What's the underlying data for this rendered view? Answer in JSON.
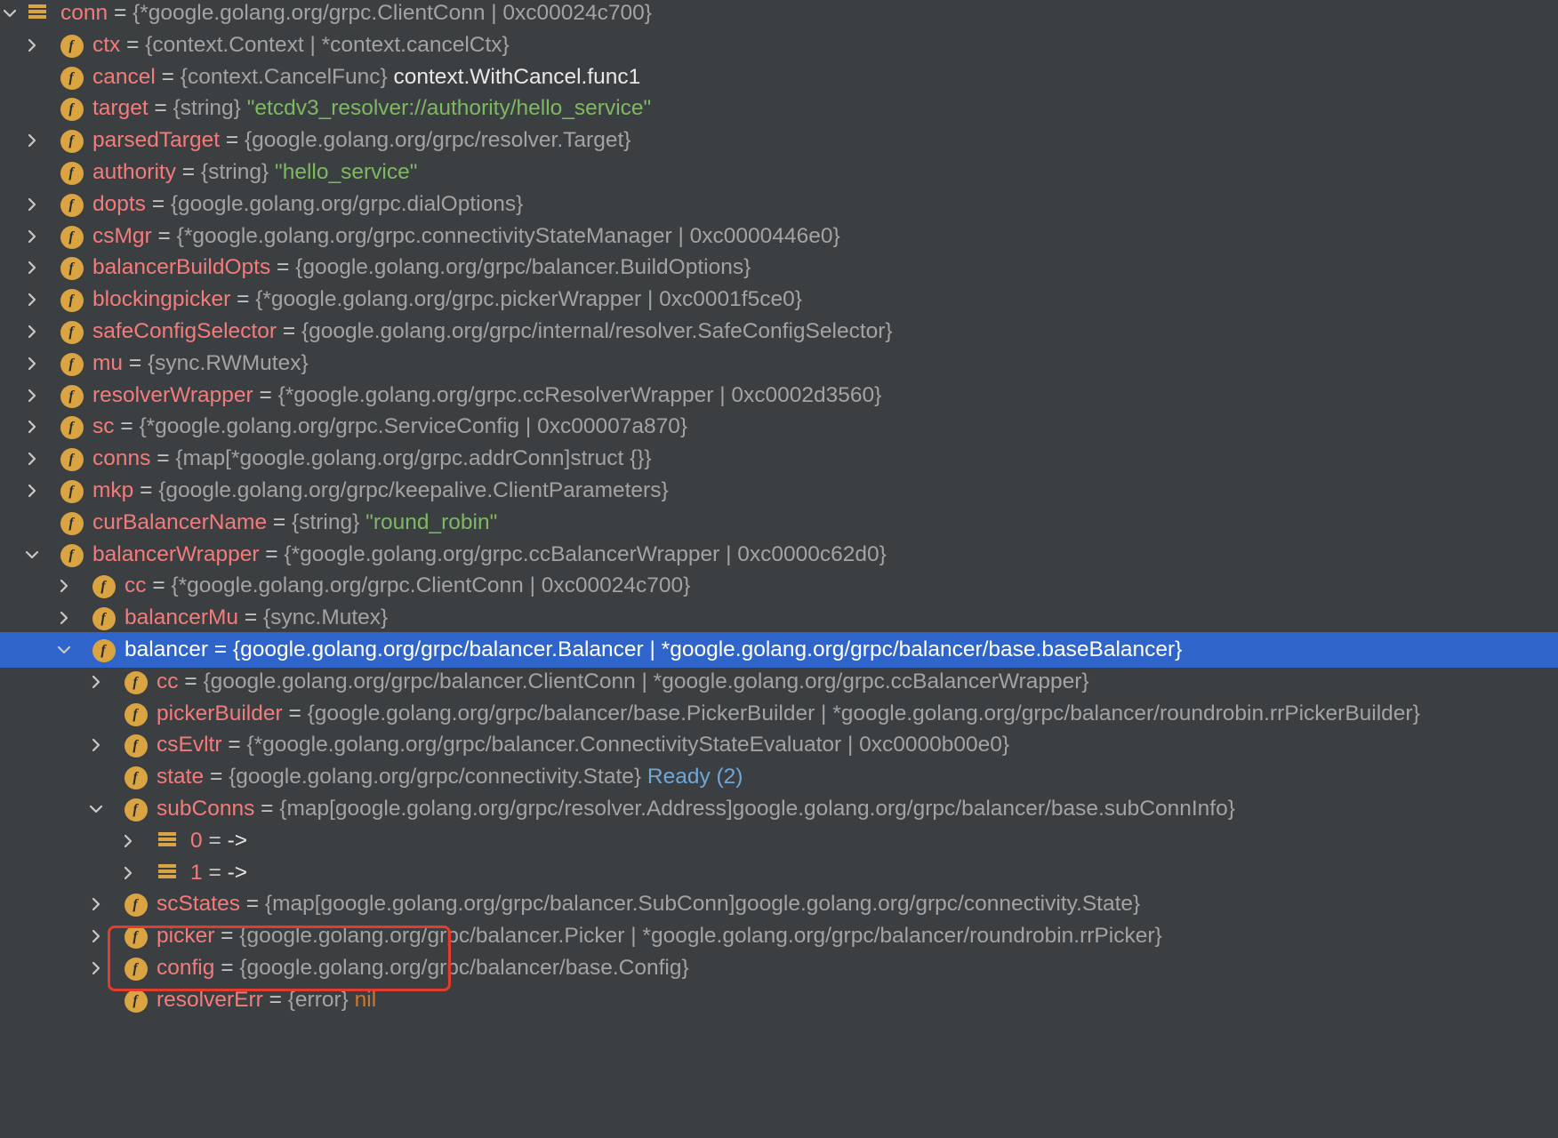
{
  "variables": [
    {
      "depth": 0,
      "expand": "expanded",
      "icon": "array-icon",
      "name": "conn",
      "type": "{*google.golang.org/grpc.ClientConn | 0xc00024c700}",
      "value": "",
      "value_kind": ""
    },
    {
      "depth": 1,
      "expand": "collapsed",
      "icon": "field-icon",
      "name": "ctx",
      "type": "{context.Context | *context.cancelCtx}",
      "value": "",
      "value_kind": ""
    },
    {
      "depth": 1,
      "expand": "none",
      "icon": "field-icon",
      "name": "cancel",
      "type": "{context.CancelFunc}",
      "value": "context.WithCancel.func1",
      "value_kind": "plain"
    },
    {
      "depth": 1,
      "expand": "none",
      "icon": "field-icon",
      "name": "target",
      "type": "{string}",
      "value": "\"etcdv3_resolver://authority/hello_service\"",
      "value_kind": "string"
    },
    {
      "depth": 1,
      "expand": "collapsed",
      "icon": "field-icon",
      "name": "parsedTarget",
      "type": "{google.golang.org/grpc/resolver.Target}",
      "value": "",
      "value_kind": ""
    },
    {
      "depth": 1,
      "expand": "none",
      "icon": "field-icon",
      "name": "authority",
      "type": "{string}",
      "value": "\"hello_service\"",
      "value_kind": "string"
    },
    {
      "depth": 1,
      "expand": "collapsed",
      "icon": "field-icon",
      "name": "dopts",
      "type": "{google.golang.org/grpc.dialOptions}",
      "value": "",
      "value_kind": ""
    },
    {
      "depth": 1,
      "expand": "collapsed",
      "icon": "field-icon",
      "name": "csMgr",
      "type": "{*google.golang.org/grpc.connectivityStateManager | 0xc0000446e0}",
      "value": "",
      "value_kind": ""
    },
    {
      "depth": 1,
      "expand": "collapsed",
      "icon": "field-icon",
      "name": "balancerBuildOpts",
      "type": "{google.golang.org/grpc/balancer.BuildOptions}",
      "value": "",
      "value_kind": ""
    },
    {
      "depth": 1,
      "expand": "collapsed",
      "icon": "field-icon",
      "name": "blockingpicker",
      "type": "{*google.golang.org/grpc.pickerWrapper | 0xc0001f5ce0}",
      "value": "",
      "value_kind": ""
    },
    {
      "depth": 1,
      "expand": "collapsed",
      "icon": "field-icon",
      "name": "safeConfigSelector",
      "type": "{google.golang.org/grpc/internal/resolver.SafeConfigSelector}",
      "value": "",
      "value_kind": ""
    },
    {
      "depth": 1,
      "expand": "collapsed",
      "icon": "field-icon",
      "name": "mu",
      "type": "{sync.RWMutex}",
      "value": "",
      "value_kind": ""
    },
    {
      "depth": 1,
      "expand": "collapsed",
      "icon": "field-icon",
      "name": "resolverWrapper",
      "type": "{*google.golang.org/grpc.ccResolverWrapper | 0xc0002d3560}",
      "value": "",
      "value_kind": ""
    },
    {
      "depth": 1,
      "expand": "collapsed",
      "icon": "field-icon",
      "name": "sc",
      "type": "{*google.golang.org/grpc.ServiceConfig | 0xc00007a870}",
      "value": "",
      "value_kind": ""
    },
    {
      "depth": 1,
      "expand": "collapsed",
      "icon": "field-icon",
      "name": "conns",
      "type": "{map[*google.golang.org/grpc.addrConn]struct {}}",
      "value": "",
      "value_kind": ""
    },
    {
      "depth": 1,
      "expand": "collapsed",
      "icon": "field-icon",
      "name": "mkp",
      "type": "{google.golang.org/grpc/keepalive.ClientParameters}",
      "value": "",
      "value_kind": ""
    },
    {
      "depth": 1,
      "expand": "none",
      "icon": "field-icon",
      "name": "curBalancerName",
      "type": "{string}",
      "value": "\"round_robin\"",
      "value_kind": "string"
    },
    {
      "depth": 1,
      "expand": "expanded",
      "icon": "field-icon",
      "name": "balancerWrapper",
      "type": "{*google.golang.org/grpc.ccBalancerWrapper | 0xc0000c62d0}",
      "value": "",
      "value_kind": ""
    },
    {
      "depth": 2,
      "expand": "collapsed",
      "icon": "field-icon",
      "name": "cc",
      "type": "{*google.golang.org/grpc.ClientConn | 0xc00024c700}",
      "value": "",
      "value_kind": ""
    },
    {
      "depth": 2,
      "expand": "collapsed",
      "icon": "field-icon",
      "name": "balancerMu",
      "type": "{sync.Mutex}",
      "value": "",
      "value_kind": ""
    },
    {
      "depth": 2,
      "expand": "expanded",
      "icon": "field-icon",
      "name": "balancer",
      "type": "{google.golang.org/grpc/balancer.Balancer | *google.golang.org/grpc/balancer/base.baseBalancer}",
      "value": "",
      "value_kind": "",
      "selected": true
    },
    {
      "depth": 3,
      "expand": "collapsed",
      "icon": "field-icon",
      "name": "cc",
      "type": "{google.golang.org/grpc/balancer.ClientConn | *google.golang.org/grpc.ccBalancerWrapper}",
      "value": "",
      "value_kind": ""
    },
    {
      "depth": 3,
      "expand": "none",
      "icon": "field-icon",
      "name": "pickerBuilder",
      "type": "{google.golang.org/grpc/balancer/base.PickerBuilder | *google.golang.org/grpc/balancer/roundrobin.rrPickerBuilder}",
      "value": "",
      "value_kind": ""
    },
    {
      "depth": 3,
      "expand": "collapsed",
      "icon": "field-icon",
      "name": "csEvltr",
      "type": "{*google.golang.org/grpc/balancer.ConnectivityStateEvaluator | 0xc0000b00e0}",
      "value": "",
      "value_kind": ""
    },
    {
      "depth": 3,
      "expand": "none",
      "icon": "field-icon",
      "name": "state",
      "type": "{google.golang.org/grpc/connectivity.State}",
      "value": "Ready (2)",
      "value_kind": "enum"
    },
    {
      "depth": 3,
      "expand": "expanded",
      "icon": "field-icon",
      "name": "subConns",
      "type": "{map[google.golang.org/grpc/resolver.Address]google.golang.org/grpc/balancer/base.subConnInfo}",
      "value": "",
      "value_kind": ""
    },
    {
      "depth": 4,
      "expand": "collapsed",
      "icon": "array-icon",
      "name": "0",
      "type": "->",
      "value": "",
      "value_kind": "",
      "is_map_entry": true
    },
    {
      "depth": 4,
      "expand": "collapsed",
      "icon": "array-icon",
      "name": "1",
      "type": "->",
      "value": "",
      "value_kind": "",
      "is_map_entry": true
    },
    {
      "depth": 3,
      "expand": "collapsed",
      "icon": "field-icon",
      "name": "scStates",
      "type": "{map[google.golang.org/grpc/balancer.SubConn]google.golang.org/grpc/connectivity.State}",
      "value": "",
      "value_kind": ""
    },
    {
      "depth": 3,
      "expand": "collapsed",
      "icon": "field-icon",
      "name": "picker",
      "type": "{google.golang.org/grpc/balancer.Picker | *google.golang.org/grpc/balancer/roundrobin.rrPicker}",
      "value": "",
      "value_kind": ""
    },
    {
      "depth": 3,
      "expand": "collapsed",
      "icon": "field-icon",
      "name": "config",
      "type": "{google.golang.org/grpc/balancer/base.Config}",
      "value": "",
      "value_kind": ""
    },
    {
      "depth": 3,
      "expand": "none",
      "icon": "field-icon",
      "name": "resolverErr",
      "type": "{error}",
      "value": "nil",
      "value_kind": "nil"
    }
  ],
  "field_icon_letter": "f",
  "assign_sign": "=",
  "colors": {
    "background": "#3c3f41",
    "selection": "#2f65ca",
    "name": "#f47b7b",
    "type": "#a3a3a3",
    "string": "#7fb862",
    "enum": "#6fa7d8",
    "nil": "#cc7832",
    "icon": "#d9a441",
    "highlight_box": "#e53b2c"
  }
}
